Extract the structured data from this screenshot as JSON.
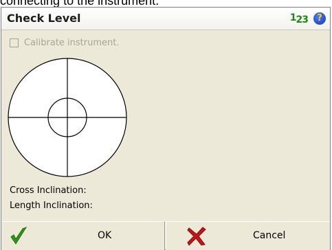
{
  "top_caption": "connecting to the instrument.",
  "title": "Check Level",
  "input_mode": {
    "first": "1",
    "second": "2",
    "third": "3"
  },
  "help_icon": {
    "glyph": "?",
    "name": "help-icon",
    "color": "#1438b8"
  },
  "calibrate": {
    "label": "Calibrate instrument.",
    "checked": false,
    "enabled": false
  },
  "cross_inclination": {
    "label": "Cross Inclination:"
  },
  "length_inclination": {
    "label": "Length Inclination:"
  },
  "buttons": {
    "ok": {
      "label": "OK",
      "icon": "checkmark-icon",
      "color": "#2a9a12"
    },
    "cancel": {
      "label": "Cancel",
      "icon": "x-mark-icon",
      "color": "#c41616"
    }
  }
}
